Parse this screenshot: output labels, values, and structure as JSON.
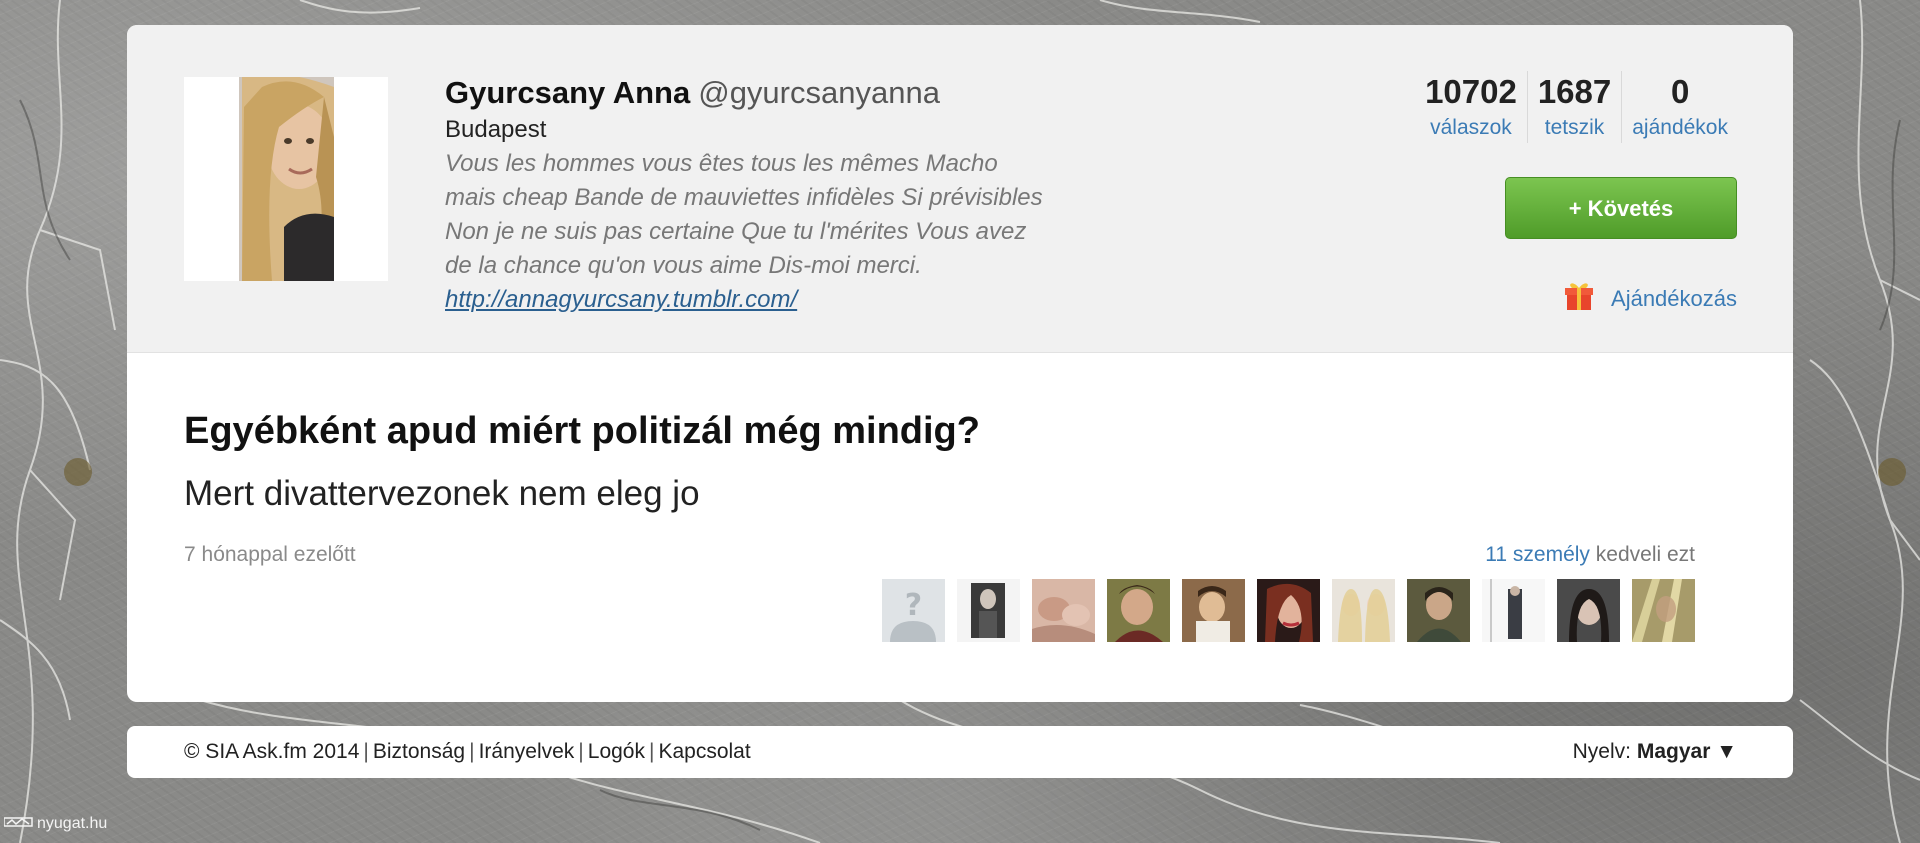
{
  "profile": {
    "name": "Gyurcsany Anna",
    "handle": "@gyurcsanyanna",
    "location": "Budapest",
    "bio": "Vous les hommes vous êtes tous les mêmes Macho\nmais cheap Bande de mauviettes infidèles Si prévisibles\nNon je ne suis pas certaine Que tu l'mérites Vous avez\nde la chance qu'on vous aime Dis-moi merci.",
    "link": "http://annagyurcsany.tumblr.com/"
  },
  "stats": [
    {
      "value": "10702",
      "label": "válaszok"
    },
    {
      "value": "1687",
      "label": "tetszik"
    },
    {
      "value": "0",
      "label": "ajándékok"
    }
  ],
  "actions": {
    "follow_label": "+ Követés",
    "gift_label": "Ajándékozás",
    "gift_icon": "gift-icon"
  },
  "answer": {
    "question": "Egyébként apud miért politizál még mindig?",
    "text": "Mert divattervezonek nem eleg jo",
    "timestamp": "7 hónappal ezelőtt",
    "likes_count_text": "11 személy",
    "likes_suffix": "kedveli ezt",
    "likers": [
      {
        "icon": "default-avatar-icon"
      },
      {
        "icon": "user-photo-icon"
      },
      {
        "icon": "user-photo-icon"
      },
      {
        "icon": "user-photo-icon"
      },
      {
        "icon": "user-photo-icon"
      },
      {
        "icon": "user-photo-icon"
      },
      {
        "icon": "user-photo-icon"
      },
      {
        "icon": "user-photo-icon"
      },
      {
        "icon": "user-photo-icon"
      },
      {
        "icon": "user-photo-icon"
      },
      {
        "icon": "user-photo-icon"
      }
    ]
  },
  "footer": {
    "copyright": "© SIA Ask.fm 2014",
    "links": [
      "Biztonság",
      "Irányelvek",
      "Logók",
      "Kapcsolat"
    ],
    "language_label": "Nyelv:",
    "language_value": "Magyar ▼"
  },
  "watermark": "nyugat.hu",
  "colors": {
    "link_blue": "#3b7bb5",
    "follow_green": "#5aa832",
    "header_bg": "#f1f1f1"
  }
}
